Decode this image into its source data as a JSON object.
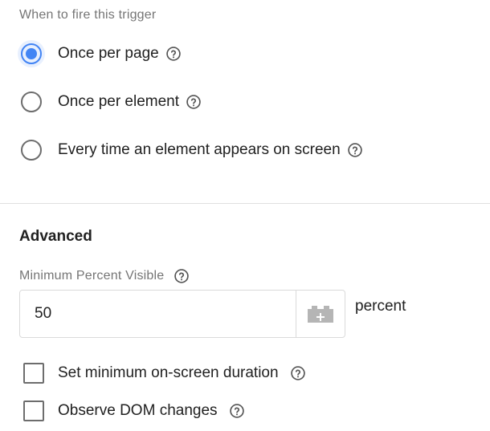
{
  "trigger_firing": {
    "label": "When to fire this trigger",
    "options": [
      {
        "label": "Once per page",
        "checked": true
      },
      {
        "label": "Once per element",
        "checked": false
      },
      {
        "label": "Every time an element appears on screen",
        "checked": false
      }
    ]
  },
  "advanced": {
    "title": "Advanced",
    "min_percent": {
      "label": "Minimum Percent Visible",
      "value": "50",
      "suffix": "percent"
    },
    "checkboxes": [
      {
        "label": "Set minimum on-screen duration",
        "checked": false
      },
      {
        "label": "Observe DOM changes",
        "checked": false
      }
    ]
  },
  "icons": {
    "help": "help-circle-icon",
    "variable": "variable-picker-icon",
    "radio": "radio-button-icon"
  },
  "colors": {
    "accent": "#4285f4",
    "text": "#212121",
    "muted": "#757575",
    "border": "#dadada",
    "divider": "#e0e0e0"
  }
}
